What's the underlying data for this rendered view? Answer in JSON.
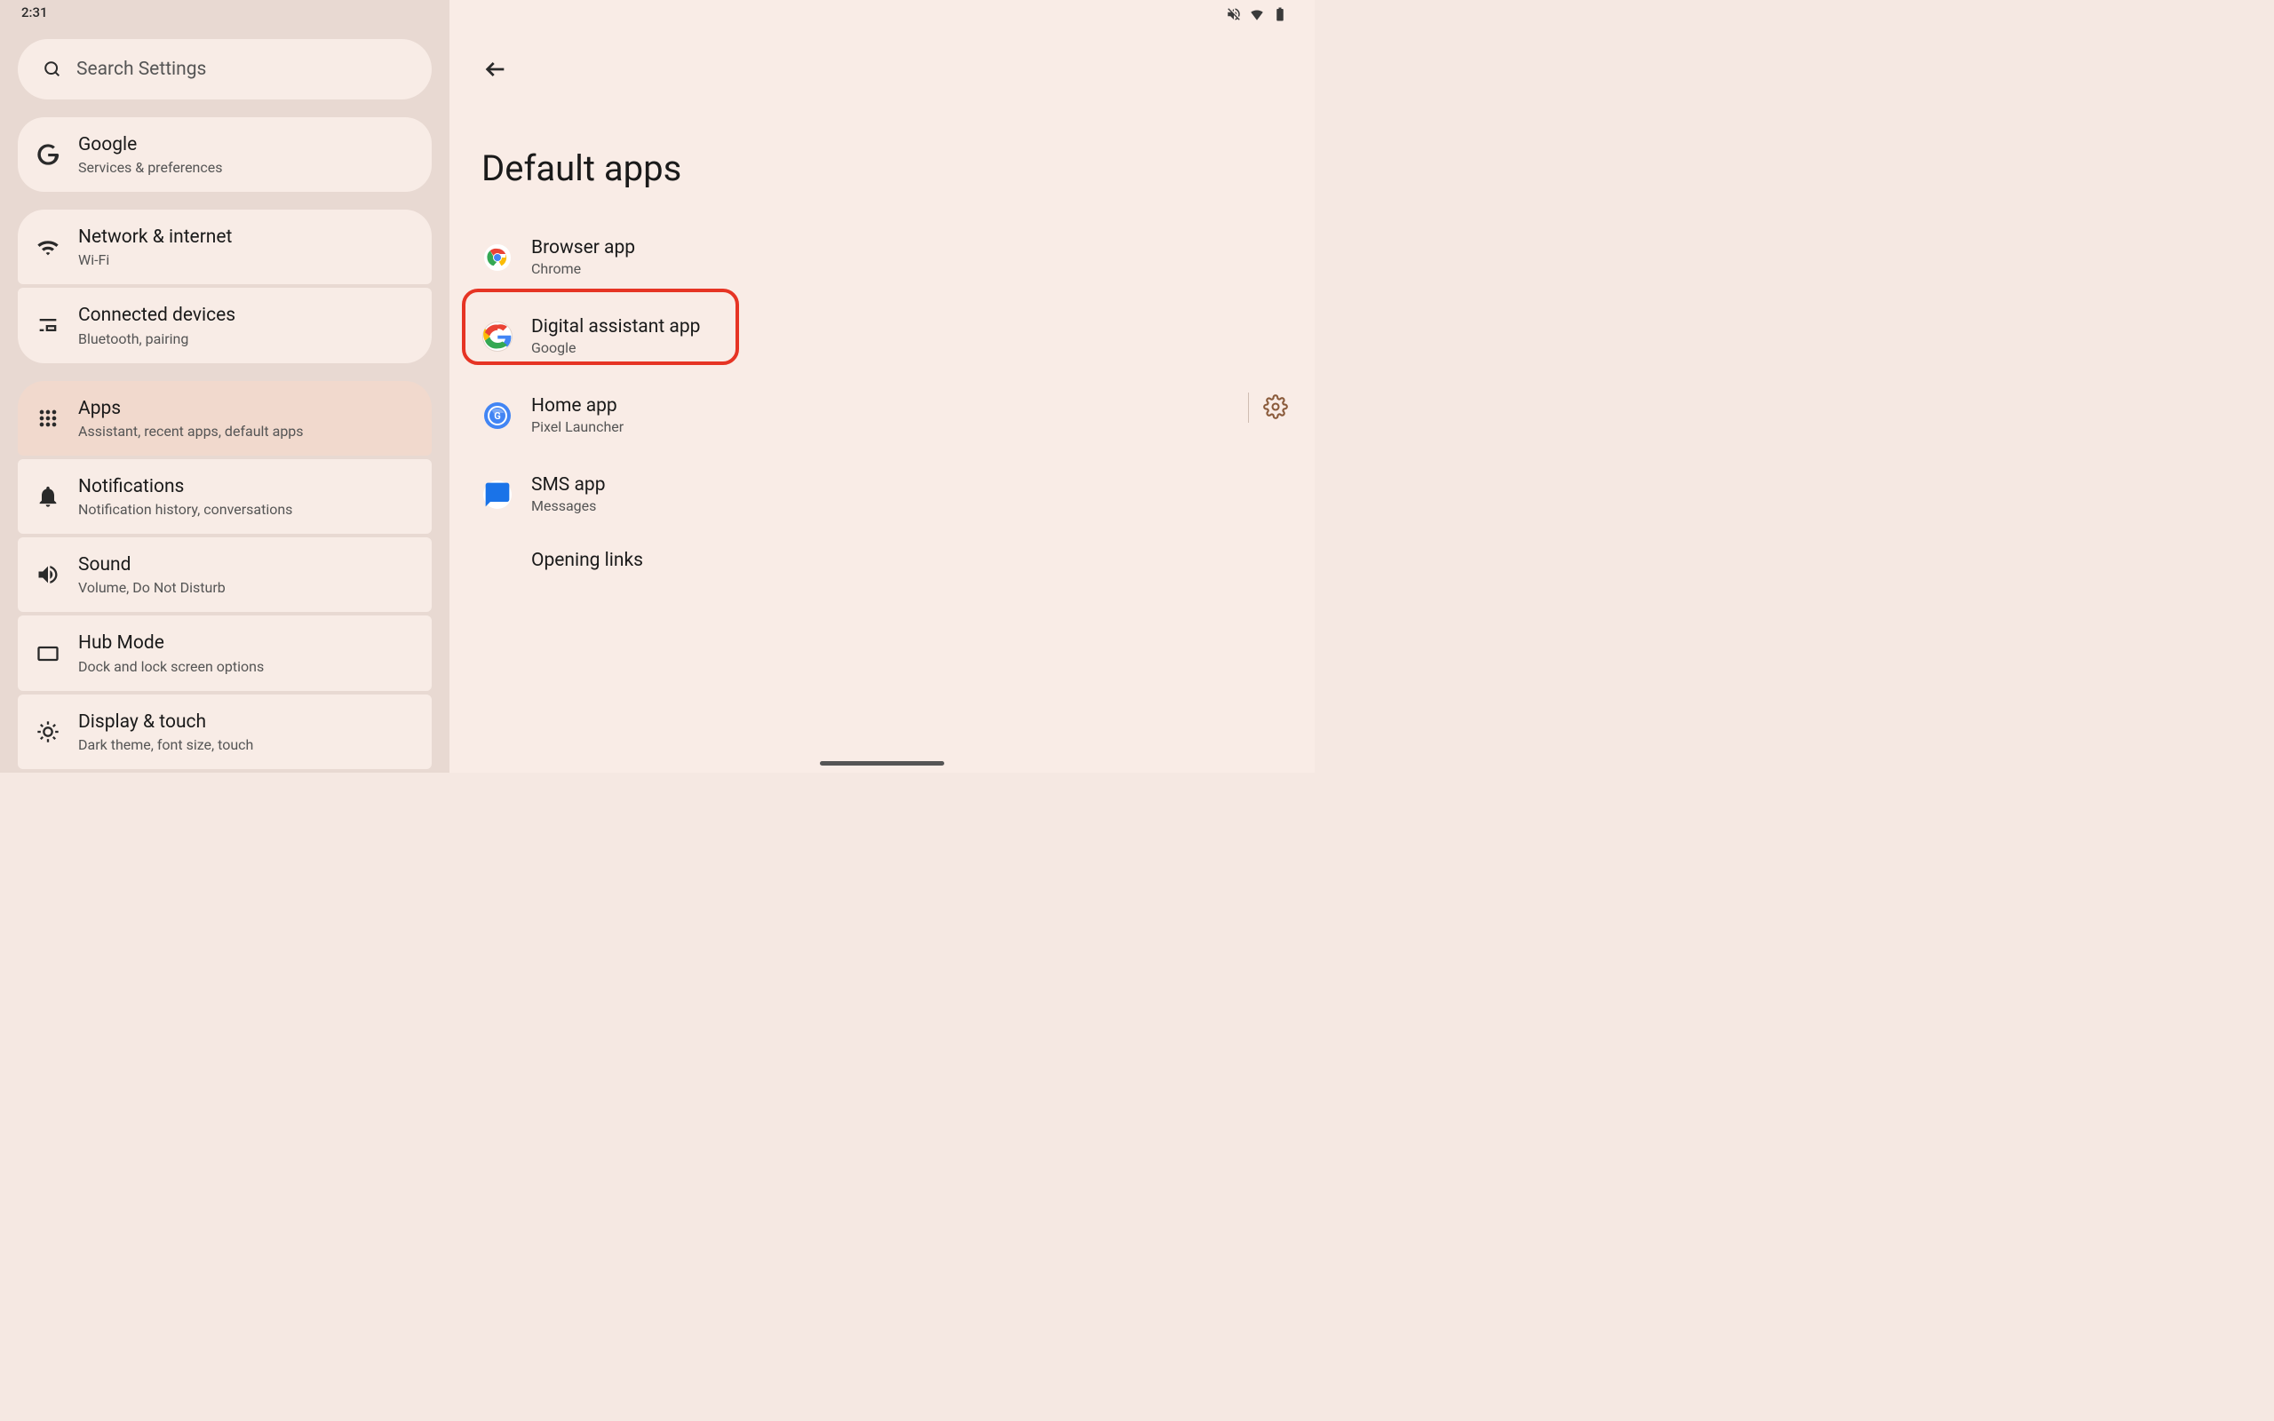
{
  "statusbar": {
    "time": "2:31"
  },
  "search": {
    "placeholder": "Search Settings"
  },
  "sidebar": {
    "items": [
      {
        "title": "Google",
        "sub": "Services & preferences",
        "icon": "google"
      },
      {
        "title": "Network & internet",
        "sub": "Wi-Fi",
        "icon": "wifi"
      },
      {
        "title": "Connected devices",
        "sub": "Bluetooth, pairing",
        "icon": "devices"
      },
      {
        "title": "Apps",
        "sub": "Assistant, recent apps, default apps",
        "icon": "apps",
        "selected": true
      },
      {
        "title": "Notifications",
        "sub": "Notification history, conversations",
        "icon": "bell"
      },
      {
        "title": "Sound",
        "sub": "Volume, Do Not Disturb",
        "icon": "sound"
      },
      {
        "title": "Hub Mode",
        "sub": "Dock and lock screen options",
        "icon": "hub"
      },
      {
        "title": "Display & touch",
        "sub": "Dark theme, font size, touch",
        "icon": "display"
      }
    ]
  },
  "main": {
    "title": "Default apps",
    "items": [
      {
        "title": "Browser app",
        "sub": "Chrome",
        "icon": "chrome"
      },
      {
        "title": "Digital assistant app",
        "sub": "Google",
        "icon": "google-color",
        "highlighted": true
      },
      {
        "title": "Home app",
        "sub": "Pixel Launcher",
        "icon": "pixel",
        "has_gear": true
      },
      {
        "title": "SMS app",
        "sub": "Messages",
        "icon": "messages"
      },
      {
        "title": "Opening links",
        "sub": "",
        "icon": ""
      }
    ]
  }
}
